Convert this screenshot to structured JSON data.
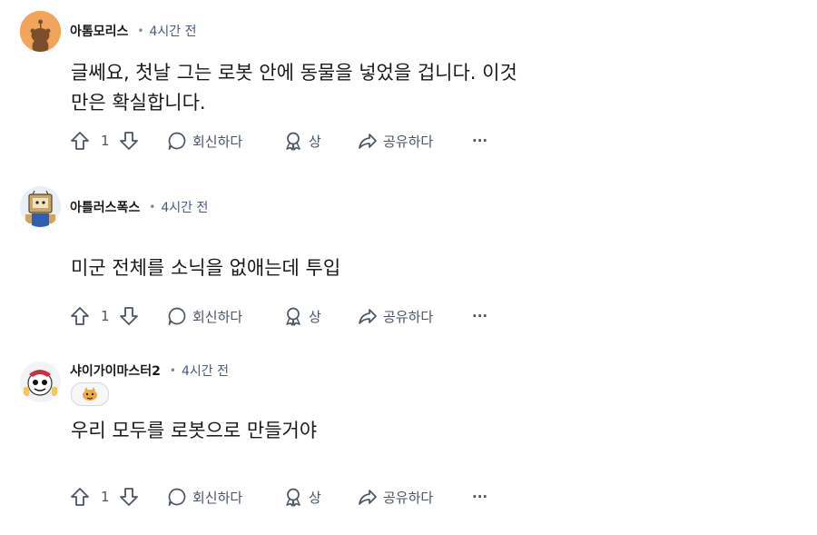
{
  "comments": [
    {
      "username": "아톰모리스",
      "time": "4시간 전",
      "text_lines": [
        "글쎄요, 첫날 그는 로봇 안에 동물을 넣었을 겁니다. 이것",
        "만은 확실합니다."
      ],
      "vote_count": "1",
      "reply_label": "회신하다",
      "award_label": "상",
      "share_label": "공유하다",
      "more_label": "···"
    },
    {
      "username": "아틀러스폭스",
      "time": "4시간 전",
      "text_lines": [
        "미군 전체를 소닉을 없애는데 투입"
      ],
      "vote_count": "1",
      "reply_label": "회신하다",
      "award_label": "상",
      "share_label": "공유하다",
      "more_label": "···"
    },
    {
      "username": "샤이가이마스터2",
      "time": "4시간 전",
      "text_lines": [
        "우리 모두를 로봇으로 만들거야"
      ],
      "vote_count": "1",
      "reply_label": "회신하다",
      "award_label": "상",
      "share_label": "공유하다",
      "more_label": "···"
    }
  ],
  "colors": {
    "text": "#1a1a1b",
    "meta": "#4a5a7a",
    "action": "#4b5563",
    "avatar1_bg": "#f0a55b"
  },
  "icons": [
    "upvote-icon",
    "downvote-icon",
    "comment-icon",
    "award-icon",
    "share-icon",
    "more-icon"
  ]
}
